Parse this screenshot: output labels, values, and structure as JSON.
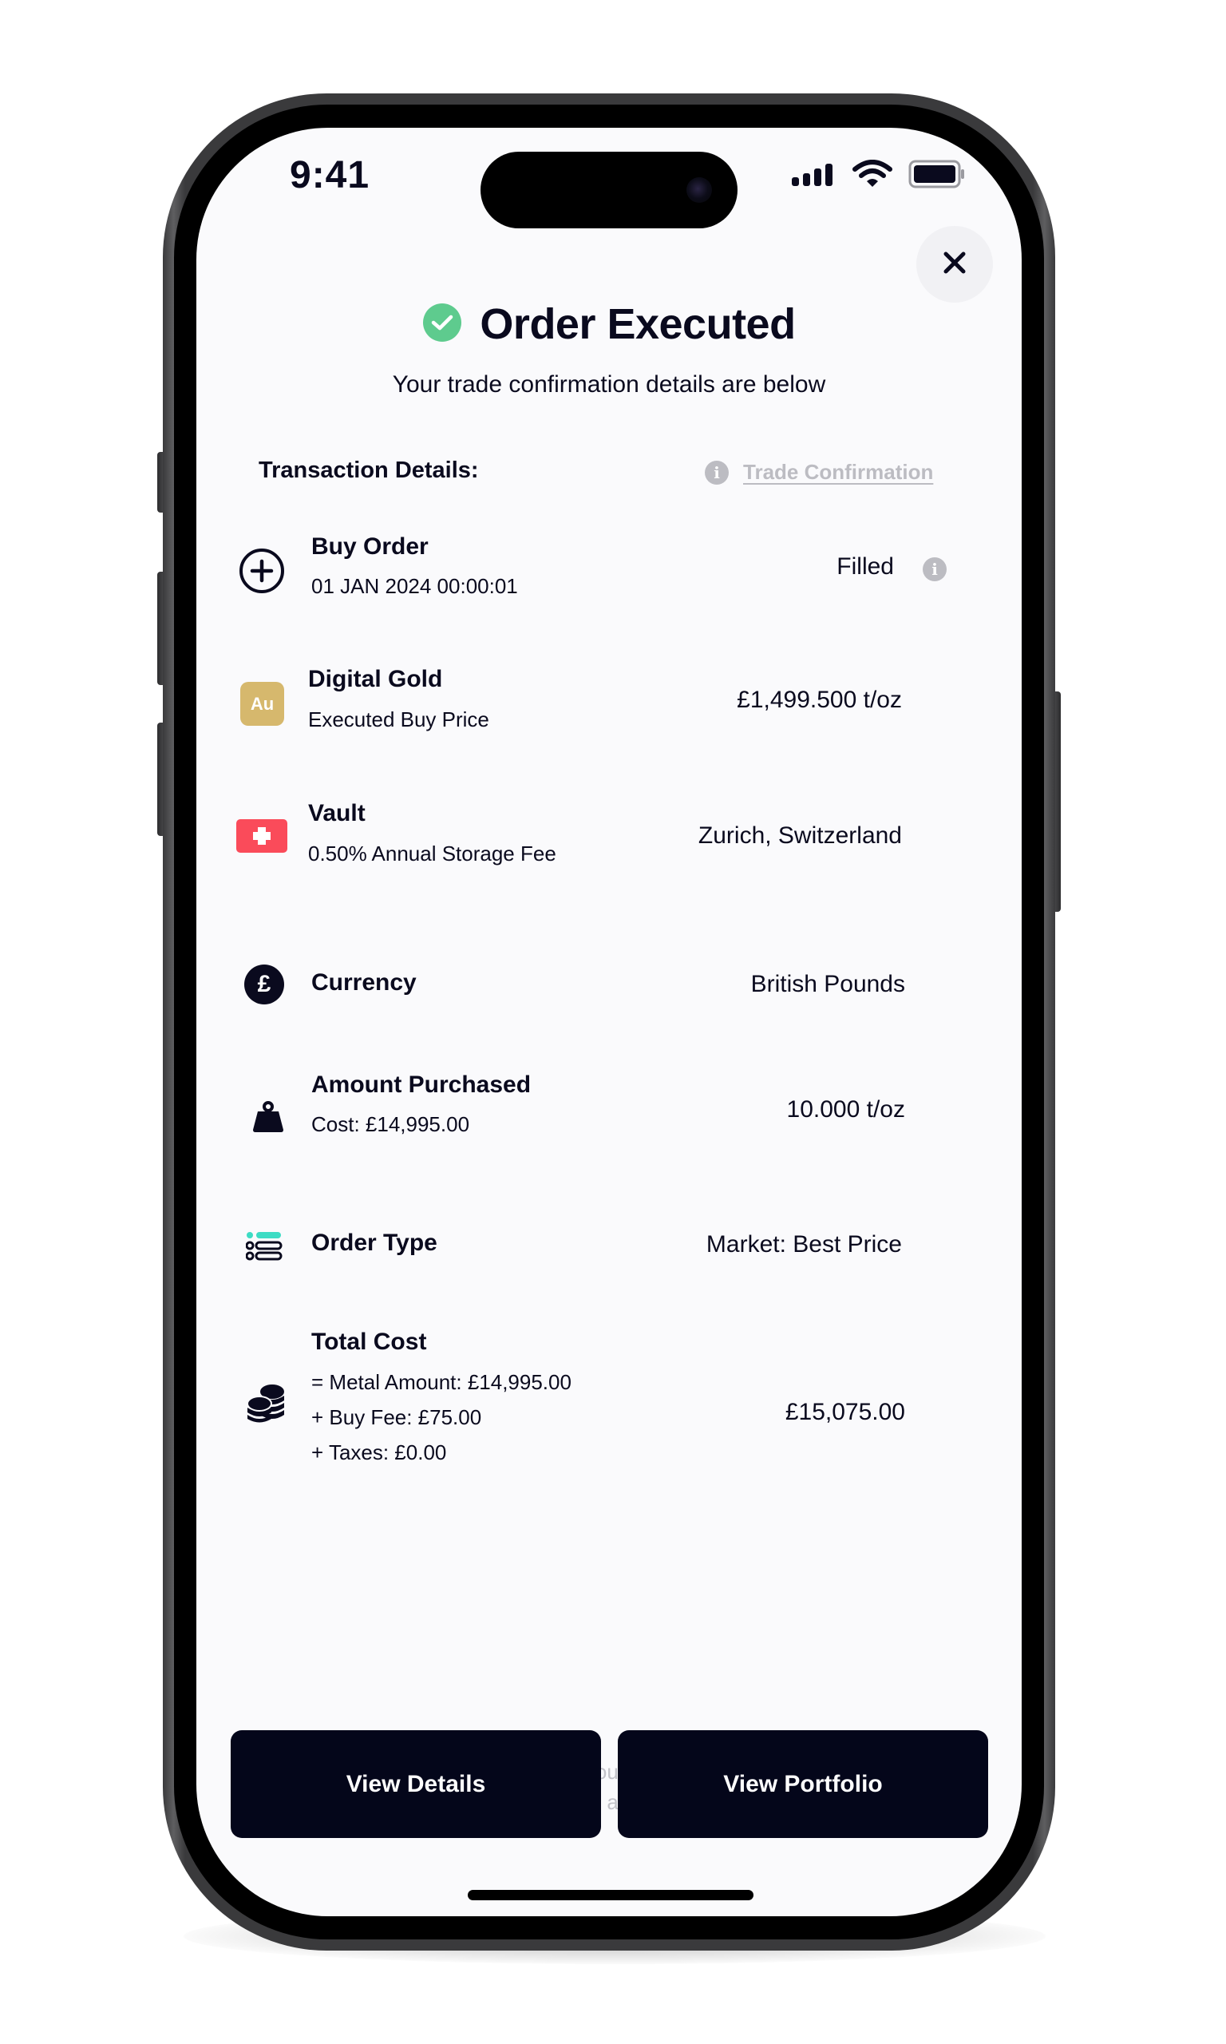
{
  "status_bar": {
    "time": "9:41",
    "icons": [
      "signal-icon",
      "wifi-icon",
      "battery-icon"
    ]
  },
  "header": {
    "close_icon": "close-icon",
    "status_icon": "check-circle-icon",
    "title": "Order Executed",
    "subtitle": "Your trade confirmation details are below"
  },
  "section": {
    "label": "Transaction Details:",
    "trade_confirmation_link": "Trade Confirmation",
    "info_glyph": "i"
  },
  "rows": [
    {
      "icon": "plus-circle-icon",
      "title": "Buy Order",
      "subtitle": "01 JAN 2024 00:00:01",
      "value": "Filled",
      "value_info": true
    },
    {
      "icon": "gold-badge-icon",
      "icon_text": "Au",
      "title": "Digital Gold",
      "subtitle": "Executed Buy Price",
      "value": "£1,499.500 t/oz"
    },
    {
      "icon": "swiss-flag-icon",
      "title": "Vault",
      "subtitle": "0.50% Annual Storage Fee",
      "value": "Zurich, Switzerland"
    },
    {
      "icon": "pound-circle-icon",
      "icon_text": "£",
      "title": "Currency",
      "value": "British Pounds"
    },
    {
      "icon": "weight-icon",
      "title": "Amount Purchased",
      "subtitle": "Cost: £14,995.00",
      "value": "10.000 t/oz"
    },
    {
      "icon": "order-type-list-icon",
      "title": "Order Type",
      "value": "Market: Best Price"
    },
    {
      "icon": "coins-icon",
      "title": "Total Cost",
      "breakdown": [
        "= Metal Amount: £14,995.00",
        "+ Buy Fee: £75.00",
        "+ Taxes: £0.00"
      ],
      "value": "£15,075.00"
    }
  ],
  "footer": {
    "note_line1": "Your holdings will be shown in your portfolio where you will be able",
    "note_line2": "to track their value, gains and when ready, sell them",
    "view_details_label": "View Details",
    "view_portfolio_label": "View Portfolio"
  },
  "colors": {
    "primary_dark": "#04061a",
    "success_green": "#5ecb8e",
    "gold": "#d6b86d",
    "swiss_red": "#fa4b5a",
    "accent_teal": "#3ddcc4",
    "muted_gray": "#bcbcc2"
  }
}
